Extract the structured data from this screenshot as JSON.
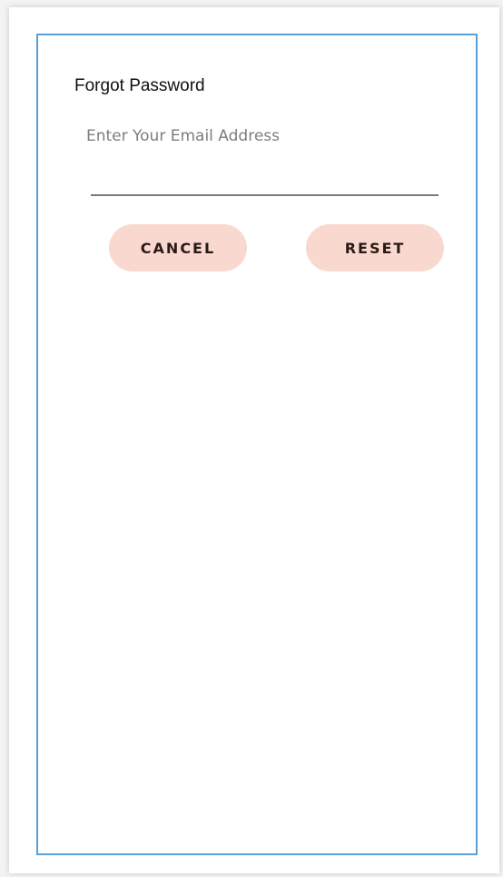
{
  "dialog": {
    "title": "Forgot Password",
    "email_placeholder": "Enter Your Email Address",
    "cancel_label": "CANCEL",
    "reset_label": "RESET"
  },
  "colors": {
    "button_background": "#f9d9cf",
    "layout_outline": "#5a9fd8",
    "input_underline": "#7a7a7a"
  }
}
